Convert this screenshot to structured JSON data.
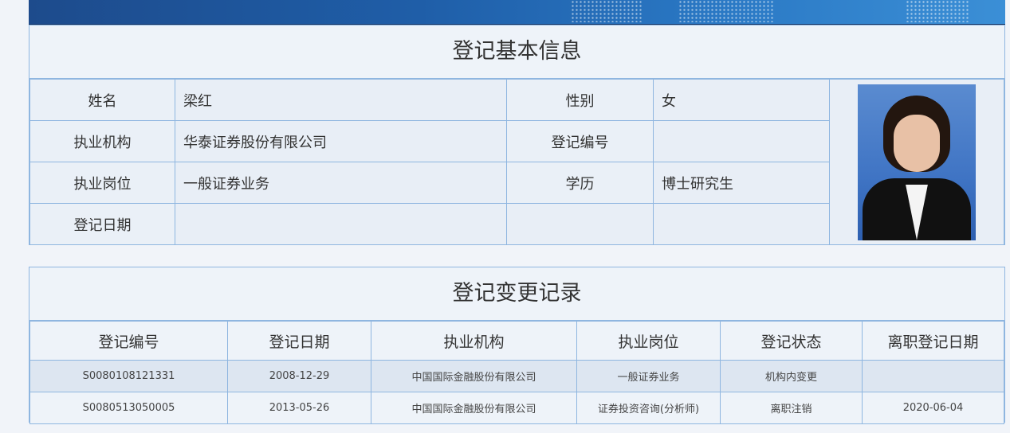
{
  "basic_info": {
    "title": "登记基本信息",
    "name_label": "姓名",
    "name_value": "梁红",
    "gender_label": "性别",
    "gender_value": "女",
    "org_label": "执业机构",
    "org_value": "华泰证券股份有限公司",
    "reg_no_label": "登记编号",
    "reg_no_value": "",
    "position_label": "执业岗位",
    "position_value": "一般证券业务",
    "education_label": "学历",
    "education_value": "博士研究生",
    "reg_date_label": "登记日期",
    "reg_date_value": ""
  },
  "change_records": {
    "title": "登记变更记录",
    "headers": [
      "登记编号",
      "登记日期",
      "执业机构",
      "执业岗位",
      "登记状态",
      "离职登记日期"
    ],
    "rows": [
      [
        "S0080108121331",
        "2008-12-29",
        "中国国际金融股份有限公司",
        "一般证券业务",
        "机构内变更",
        ""
      ],
      [
        "S0080513050005",
        "2013-05-26",
        "中国国际金融股份有限公司",
        "证券投资咨询(分析师)",
        "离职注销",
        "2020-06-04"
      ]
    ]
  }
}
